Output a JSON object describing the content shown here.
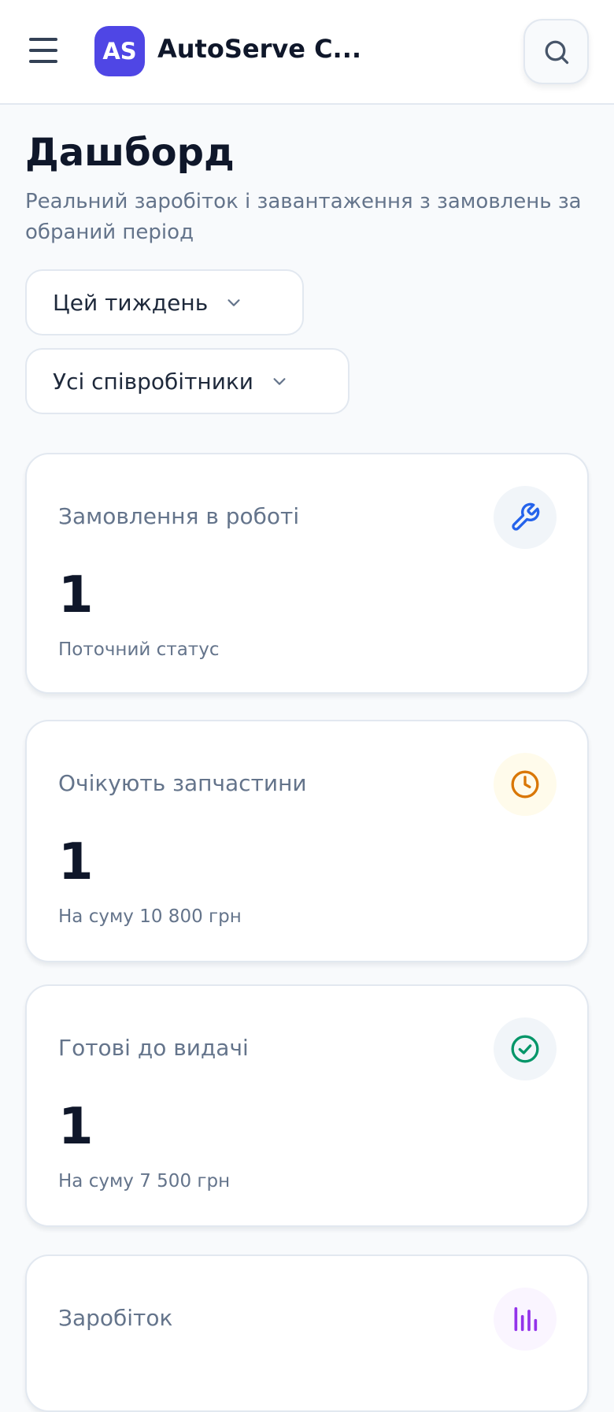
{
  "header": {
    "logo_text": "AS",
    "app_title": "AutoServe C...",
    "menu_icon": "hamburger-menu-icon",
    "search_icon": "search-icon"
  },
  "page": {
    "title": "Дашборд",
    "subtitle": "Реальний заробіток і завантаження з замовлень за обраний період"
  },
  "filters": {
    "period": {
      "value": "Цей тиждень",
      "icon": "chevron-down-icon"
    },
    "staff": {
      "value": "Усі співробітники",
      "icon": "chevron-down-icon"
    }
  },
  "cards": [
    {
      "title": "Замовлення в роботі",
      "value": "1",
      "note": "Поточний статус",
      "icon": "wrench-icon",
      "icon_color": "#2563eb",
      "icon_bg": "#f1f5f9"
    },
    {
      "title": "Очікують запчастини",
      "value": "1",
      "note": "На суму 10 800 грн",
      "icon": "clock-icon",
      "icon_color": "#d97706",
      "icon_bg": "#fffbeb"
    },
    {
      "title": "Готові до видачі",
      "value": "1",
      "note": "На суму 7 500 грн",
      "icon": "check-circle-icon",
      "icon_color": "#059669",
      "icon_bg": "#f1f5f9"
    },
    {
      "title": "Заробіток",
      "value": "",
      "note": "",
      "icon": "bar-chart-icon",
      "icon_color": "#9333ea",
      "icon_bg": "#faf5ff"
    }
  ],
  "colors": {
    "brand": "#4f46e5",
    "text_primary": "#0f172a",
    "text_muted": "#64748b",
    "border": "#e2e8f0"
  }
}
